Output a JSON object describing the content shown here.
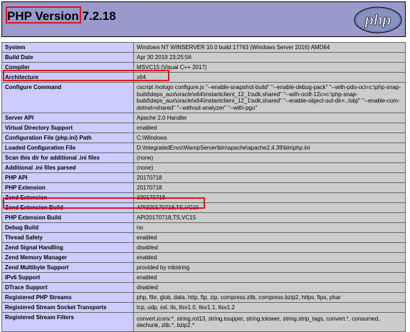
{
  "header": {
    "title": "PHP Version 7.2.18",
    "logo_text": "php"
  },
  "rows": [
    {
      "key": "System",
      "value": "Windows NT WINSERVER 10.0 build 17763 (Windows Server 2016) AMD64"
    },
    {
      "key": "Build Date",
      "value": "Apr 30 2019 23:25:56"
    },
    {
      "key": "Compiler",
      "value": "MSVC15 (Visual C++ 2017)"
    },
    {
      "key": "Architecture",
      "value": "x64"
    },
    {
      "key": "Configure Command",
      "value": "cscript /nologo configure.js \"--enable-snapshot-build\" \"--enable-debug-pack\" \"--with-pdo-oci=c:\\php-snap-build\\deps_aux\\oracle\\x64\\instantclient_12_1\\sdk,shared\" \"--with-oci8-12c=c:\\php-snap-build\\deps_aux\\oracle\\x64\\instantclient_12_1\\sdk,shared\" \"--enable-object-out-dir=../obj/\" \"--enable-com-dotnet=shared\" \"--without-analyzer\" \"--with-pgo\""
    },
    {
      "key": "Server API",
      "value": "Apache 2.0 Handler"
    },
    {
      "key": "Virtual Directory Support",
      "value": "enabled"
    },
    {
      "key": "Configuration File (php.ini) Path",
      "value": "C:\\Windows"
    },
    {
      "key": "Loaded Configuration File",
      "value": "D:\\IntegratedEnvs\\WampServer\\bin\\apache\\apache2.4.39\\bin\\php.ini"
    },
    {
      "key": "Scan this dir for additional .ini files",
      "value": "(none)"
    },
    {
      "key": "Additional .ini files parsed",
      "value": "(none)"
    },
    {
      "key": "PHP API",
      "value": "20170718"
    },
    {
      "key": "PHP Extension",
      "value": "20170718"
    },
    {
      "key": "Zend Extension",
      "value": "320170718"
    },
    {
      "key": "Zend Extension Build",
      "value": "API320170718,TS,VC15"
    },
    {
      "key": "PHP Extension Build",
      "value": "API20170718,TS,VC15"
    },
    {
      "key": "Debug Build",
      "value": "no"
    },
    {
      "key": "Thread Safety",
      "value": "enabled"
    },
    {
      "key": "Zend Signal Handling",
      "value": "disabled"
    },
    {
      "key": "Zend Memory Manager",
      "value": "enabled"
    },
    {
      "key": "Zend Multibyte Support",
      "value": "provided by mbstring"
    },
    {
      "key": "IPv6 Support",
      "value": "enabled"
    },
    {
      "key": "DTrace Support",
      "value": "disabled"
    },
    {
      "key": "Registered PHP Streams",
      "value": "php, file, glob, data, http, ftp, zip, compress.zlib, compress.bzip2, https, ftps, phar"
    },
    {
      "key": "Registered Stream Socket Transports",
      "value": "tcp, udp, ssl, tls, tlsv1.0, tlsv1.1, tlsv1.2"
    },
    {
      "key": "Registered Stream Filters",
      "value": "convert.iconv.*, string.rot13, string.toupper, string.tolower, string.strip_tags, convert.*, consumed, dechunk, zlib.*, bzip2.*"
    }
  ],
  "colors": {
    "header_bg": "#9999cc",
    "key_bg": "#ccccff",
    "value_bg": "#cccccc",
    "highlight": "#e0141e"
  }
}
